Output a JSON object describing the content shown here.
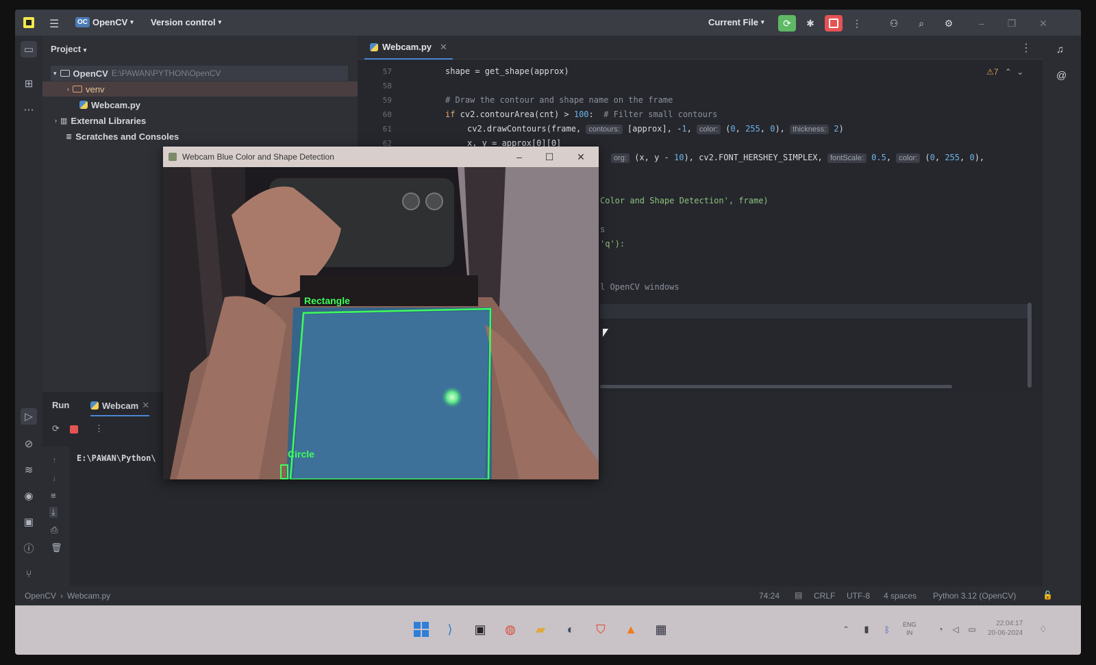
{
  "titlebar": {
    "project_badge": "OC",
    "project_name": "OpenCV",
    "version_control": "Version control",
    "run_config": "Current File"
  },
  "project_panel": {
    "title": "Project",
    "tree": {
      "root_name": "OpenCV",
      "root_path": "E:\\PAWAN\\PYTHON\\OpenCV",
      "venv": "venv",
      "file": "Webcam.py",
      "external": "External Libraries",
      "scratches": "Scratches and Consoles"
    }
  },
  "editor": {
    "tab_label": "Webcam.py",
    "warnings": "7",
    "lines": [
      {
        "num": "57",
        "code": "shape = get_shape(approx)"
      },
      {
        "num": "58",
        "code": ""
      },
      {
        "num": "59",
        "code": "# Draw the contour and shape name on the frame"
      },
      {
        "num": "60",
        "code": "if cv2.contourArea(cnt) > 100:  # Filter small contours"
      },
      {
        "num": "61",
        "code": "cv2.drawContours(frame, contours: [approx], -1, color: (0, 255, 0), thickness: 2)"
      },
      {
        "num": "62",
        "code": "x, y = approx[0][0]"
      }
    ],
    "line63_partial": "org: (x, y - 10), cv2.FONT_HERSHEY_SIMPLEX, fontScale: 0.5, color: (0, 255, 0),",
    "line66_partial": "Color and Shape Detection', frame)",
    "line68_partial": "s",
    "line69_partial": "'q'):",
    "line72_partial": "l OpenCV windows"
  },
  "run_panel": {
    "tab_run": "Run",
    "tab_webcam": "Webcam",
    "output": "E:\\PAWAN\\Python\\"
  },
  "webcam_window": {
    "title": "Webcam Blue Color and Shape Detection",
    "labels": {
      "rectangle": "Rectangle",
      "circle": "Circle"
    }
  },
  "statusbar": {
    "crumb_project": "OpenCV",
    "crumb_file": "Webcam.py",
    "position": "74:24",
    "line_sep": "CRLF",
    "encoding": "UTF-8",
    "indent": "4 spaces",
    "interpreter": "Python 3.12 (OpenCV)"
  },
  "taskbar": {
    "lang": "ENG",
    "region": "IN",
    "time": "22:04:17",
    "date": "20-06-2024"
  },
  "colors": {
    "accent_green": "#3dff5a",
    "run_green": "#5fb865",
    "stop_red": "#e55353"
  }
}
